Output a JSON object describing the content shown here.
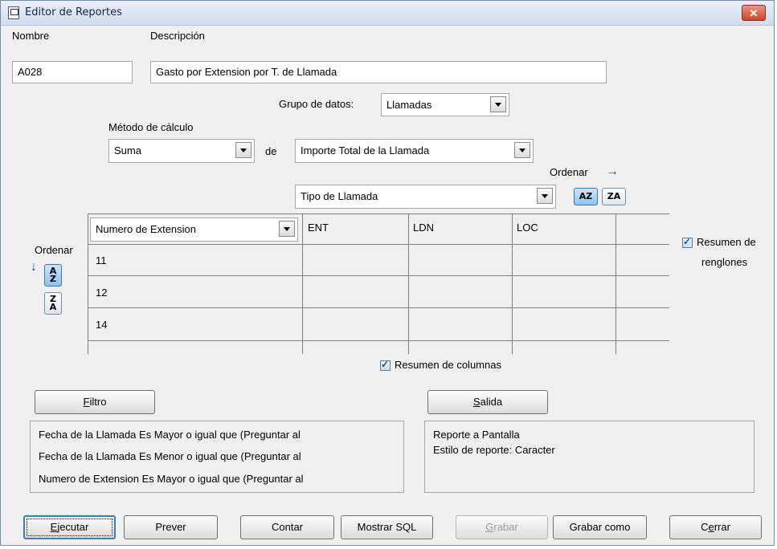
{
  "window": {
    "title": "Editor de Reportes",
    "close_glyph": "✕"
  },
  "nombre": {
    "label": "Nombre",
    "value": "A028"
  },
  "descripcion": {
    "label": "Descripción",
    "value": "Gasto por Extension por T. de Llamada"
  },
  "grupo": {
    "label": "Grupo de datos:",
    "value": "Llamadas"
  },
  "metodo": {
    "label": "Método de cálculo",
    "value": "Suma",
    "de_label": "de",
    "campo": "Importe Total de la Llamada"
  },
  "columns_sort": {
    "label": "Ordenar",
    "arrow": "→",
    "az": "AZ",
    "za": "ZA"
  },
  "column_field": "Tipo de Llamada",
  "row_field": "Numero de Extension",
  "column_headers": [
    "ENT",
    "LDN",
    "LOC"
  ],
  "rows": [
    "11",
    "12",
    "14"
  ],
  "rows_sort": {
    "label": "Ordenar",
    "arrow": "↓",
    "az_top": "A",
    "az_bottom": "Z",
    "za_top": "Z",
    "za_bottom": "A"
  },
  "resumen_renglones": {
    "line1": "Resumen de",
    "line2": "renglones",
    "checked": true
  },
  "resumen_columnas": {
    "label": "Resumen de columnas",
    "checked": true
  },
  "filtro": {
    "button_prefix": "",
    "button_accel": "F",
    "button_rest": "iltro",
    "lines": [
      "Fecha de la Llamada  Es Mayor o igual que (Preguntar al",
      "Fecha de la Llamada  Es Menor o igual que (Preguntar al",
      "Numero de Extension  Es Mayor o igual que (Preguntar al"
    ]
  },
  "salida": {
    "button_prefix": "",
    "button_accel": "S",
    "button_rest": "alida",
    "lines": [
      "Reporte a Pantalla",
      "Estilo de reporte: Caracter"
    ]
  },
  "buttons": {
    "ejecutar": {
      "accel": "E",
      "rest": "jecutar"
    },
    "prever": "Prever",
    "contar": "Contar",
    "mostrar_sql": "Mostrar SQL",
    "grabar": {
      "accel": "G",
      "rest": "rabar",
      "disabled": true
    },
    "grabar_como": "Grabar como",
    "cerrar": {
      "pre": "C",
      "accel": "e",
      "rest": "rrar"
    }
  }
}
